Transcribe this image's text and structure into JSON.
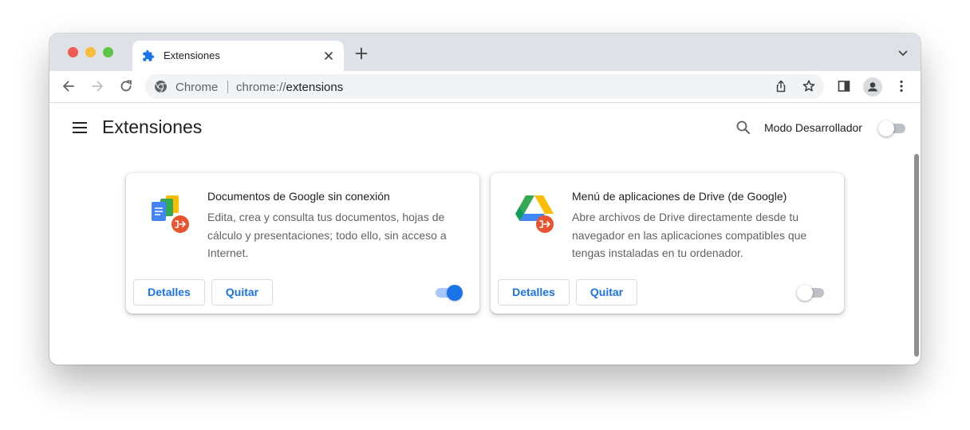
{
  "tab": {
    "title": "Extensiones"
  },
  "omnibox": {
    "chip": "Chrome",
    "url_scheme": "chrome://",
    "url_host": "extensions"
  },
  "page": {
    "title": "Extensiones",
    "developer_mode_label": "Modo Desarrollador",
    "developer_mode_enabled": false
  },
  "extensions": [
    {
      "name": "Documentos de Google sin conexión",
      "description": "Edita, crea y consulta tus documentos, hojas de cálculo y presentaciones; todo ello, sin acceso a Internet.",
      "details_label": "Detalles",
      "remove_label": "Quitar",
      "enabled": true,
      "icon": "google-docs-offline-icon"
    },
    {
      "name": "Menú de aplicaciones de Drive (de Google)",
      "description": "Abre archivos de Drive directamente desde tu navegador en las aplicaciones compatibles que tengas instaladas en tu ordenador.",
      "details_label": "Detalles",
      "remove_label": "Quitar",
      "enabled": false,
      "icon": "google-drive-launcher-icon"
    }
  ],
  "colors": {
    "accent": "#1a73e8",
    "badge": "#e8542f"
  }
}
